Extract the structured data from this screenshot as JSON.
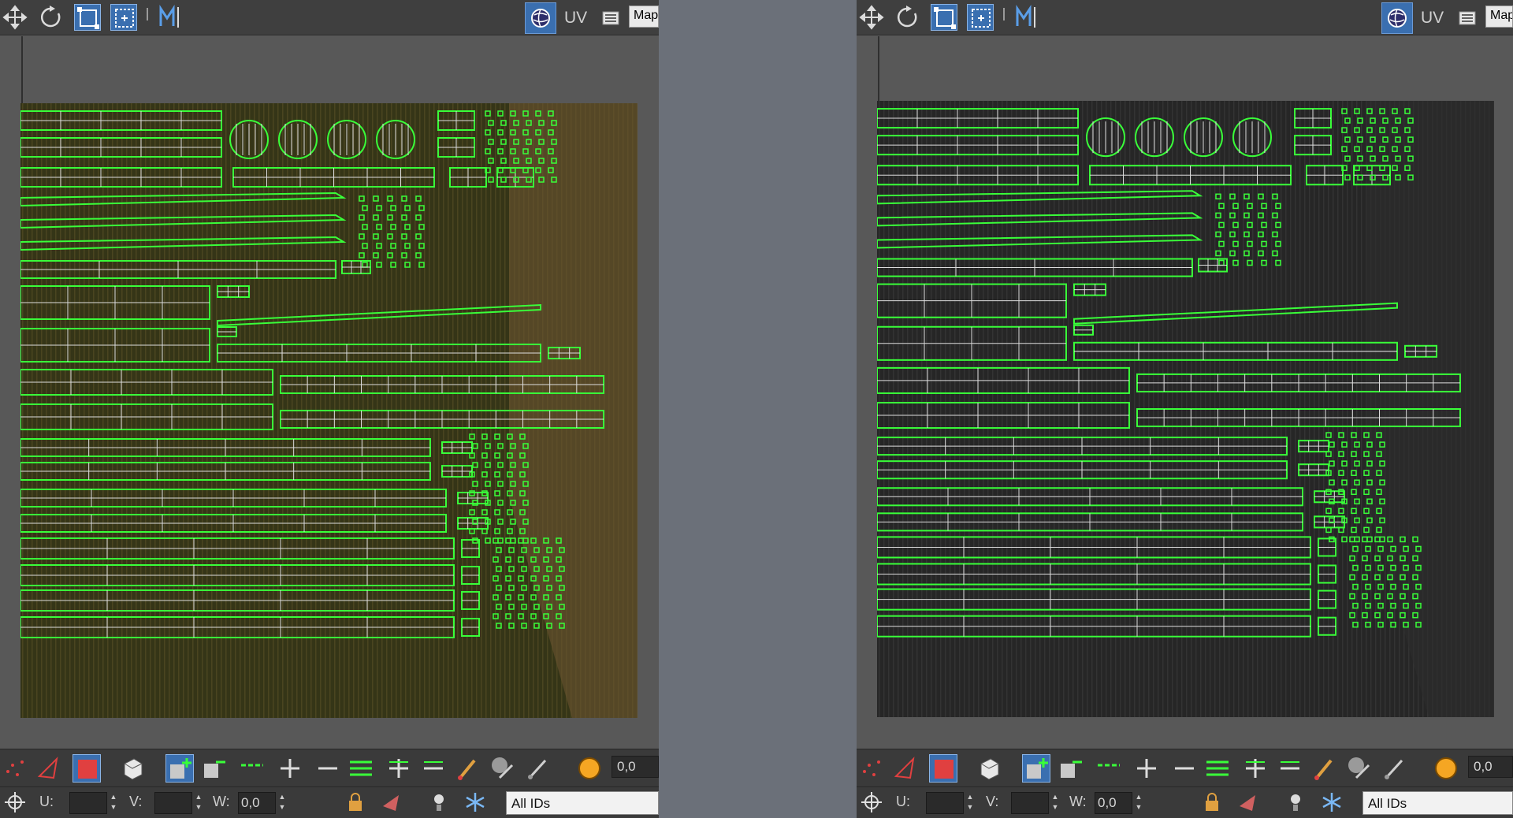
{
  "editors": [
    {
      "id": "left",
      "toolbar": {
        "uv_label": "UV",
        "map_label": "Map"
      },
      "bottom": {
        "value_field": "0,0",
        "u_label": "U:",
        "v_label": "V:",
        "w_label": "W:",
        "w_value": "0,0",
        "ids_select": "All IDs"
      },
      "texture": {
        "base": "#3a2a14",
        "overlay": "#2f4a1c",
        "stripe": "#7a5a32",
        "edge": "#8a5a3a"
      }
    },
    {
      "id": "right",
      "toolbar": {
        "uv_label": "UV",
        "map_label": "Map"
      },
      "bottom": {
        "value_field": "0,0",
        "u_label": "U:",
        "v_label": "V:",
        "w_label": "W:",
        "w_value": "0,0",
        "ids_select": "All IDs"
      },
      "texture": {
        "base": "#1f1f1f",
        "overlay": "#333333",
        "stripe": "#4a4a4a",
        "edge": "#2a2a2a"
      }
    }
  ],
  "colors": {
    "uv_wire": "#39ff39",
    "accent_blue": "#3a6fb0",
    "select_red": "#e04040"
  },
  "icons": [
    "move-icon",
    "rotate-icon",
    "scale-icon",
    "freeform-icon",
    "mirror-icon",
    "world-icon",
    "options-icon"
  ]
}
